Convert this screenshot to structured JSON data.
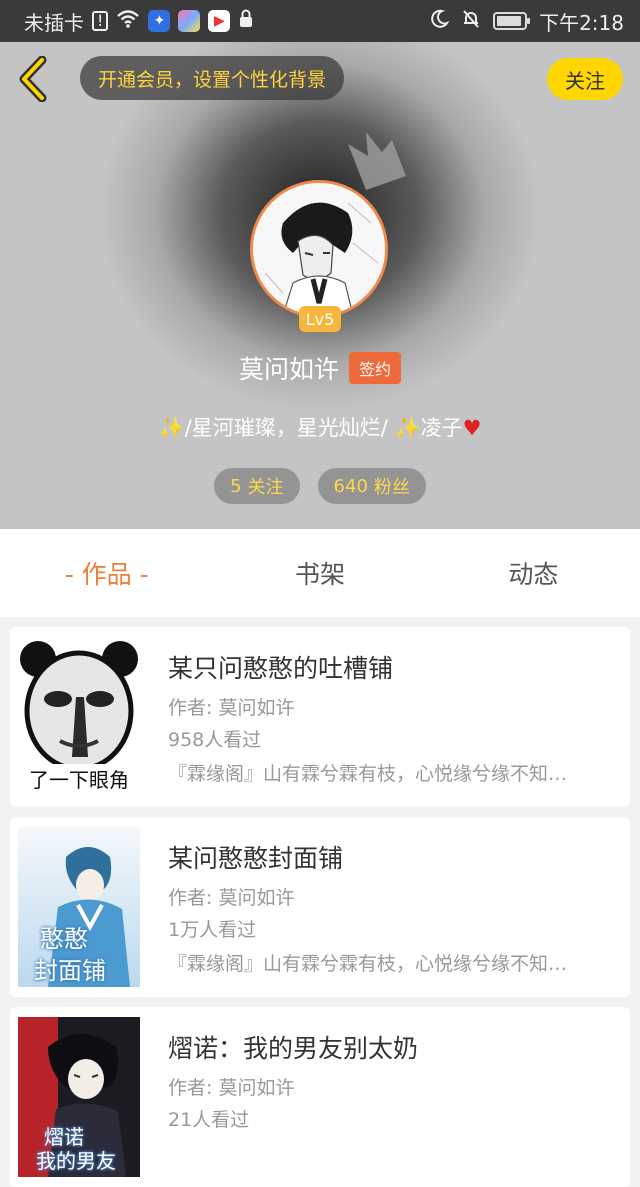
{
  "status_bar": {
    "carrier": "未插卡",
    "time": "下午2:18"
  },
  "header": {
    "vip_prompt": "开通会员，设置个性化背景",
    "follow_label": "关注",
    "level": "Lv5",
    "username": "莫问如许",
    "sign_badge": "签约",
    "bio_text1": "/星河璀璨，星光灿烂/",
    "bio_text2": "凌子",
    "follow_count": "5",
    "follow_label_stat": "关注",
    "fans_count": "640",
    "fans_label": "粉丝"
  },
  "tabs": [
    {
      "label": "- 作品 -",
      "active": true
    },
    {
      "label": "书架",
      "active": false
    },
    {
      "label": "动态",
      "active": false
    }
  ],
  "works": [
    {
      "title": "某只问憨憨的吐槽铺",
      "author": "作者: 莫问如许",
      "views": "958人看过",
      "desc": "『霖缘阁』山有霖兮霖有枝，心悦缘兮缘不知…",
      "cover_caption": "了一下眼角"
    },
    {
      "title": "某问憨憨封面铺",
      "author": "作者: 莫问如许",
      "views": "1万人看过",
      "desc": "『霖缘阁』山有霖兮霖有枝，心悦缘兮缘不知…",
      "cover_caption_1": "憨憨",
      "cover_caption_2": "封面铺"
    },
    {
      "title": "熠诺：我的男友别太奶",
      "author": "作者: 莫问如许",
      "views": "21人看过",
      "desc": "",
      "cover_caption_1": "熠诺",
      "cover_caption_2": "我的男友"
    }
  ],
  "colors": {
    "accent": "#ef7d3c",
    "follow_yellow": "#ffd600",
    "level_badge": "#f6b73c",
    "sign_badge": "#ef6a3a"
  }
}
